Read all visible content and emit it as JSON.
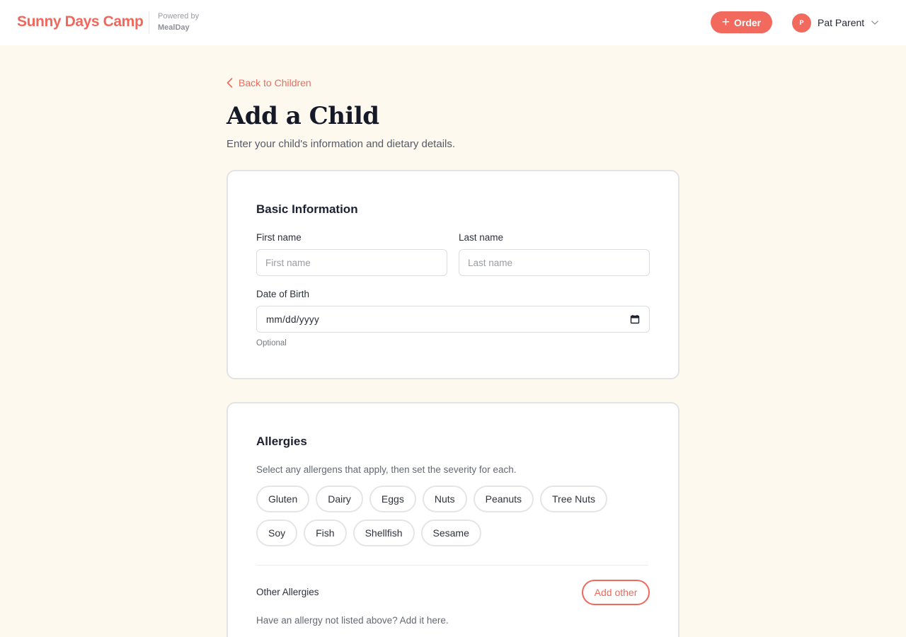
{
  "header": {
    "brand": "Sunny Days Camp",
    "powered_by": "Powered by",
    "powered_brand": "MealDay",
    "order_label": "Order",
    "user_initial": "P",
    "user_name": "Pat Parent"
  },
  "nav": {
    "back_label": "Back to Children"
  },
  "page": {
    "title": "Add a Child",
    "subtitle": "Enter your child's information and dietary details."
  },
  "basic_info": {
    "title": "Basic Information",
    "first_name_label": "First name",
    "first_name_placeholder": "First name",
    "last_name_label": "Last name",
    "last_name_placeholder": "Last name",
    "dob_label": "Date of Birth",
    "dob_value": "mm/dd/yyyy",
    "dob_hint": "Optional"
  },
  "allergies": {
    "title": "Allergies",
    "description": "Select any allergens that apply, then set the severity for each.",
    "options": [
      "Gluten",
      "Dairy",
      "Eggs",
      "Nuts",
      "Peanuts",
      "Tree Nuts",
      "Soy",
      "Fish",
      "Shellfish",
      "Sesame"
    ],
    "other_label": "Other Allergies",
    "add_other_label": "Add other",
    "other_description": "Have an allergy not listed above? Add it here."
  },
  "colors": {
    "accent": "#f26a5e",
    "background": "#fdf9ee"
  }
}
